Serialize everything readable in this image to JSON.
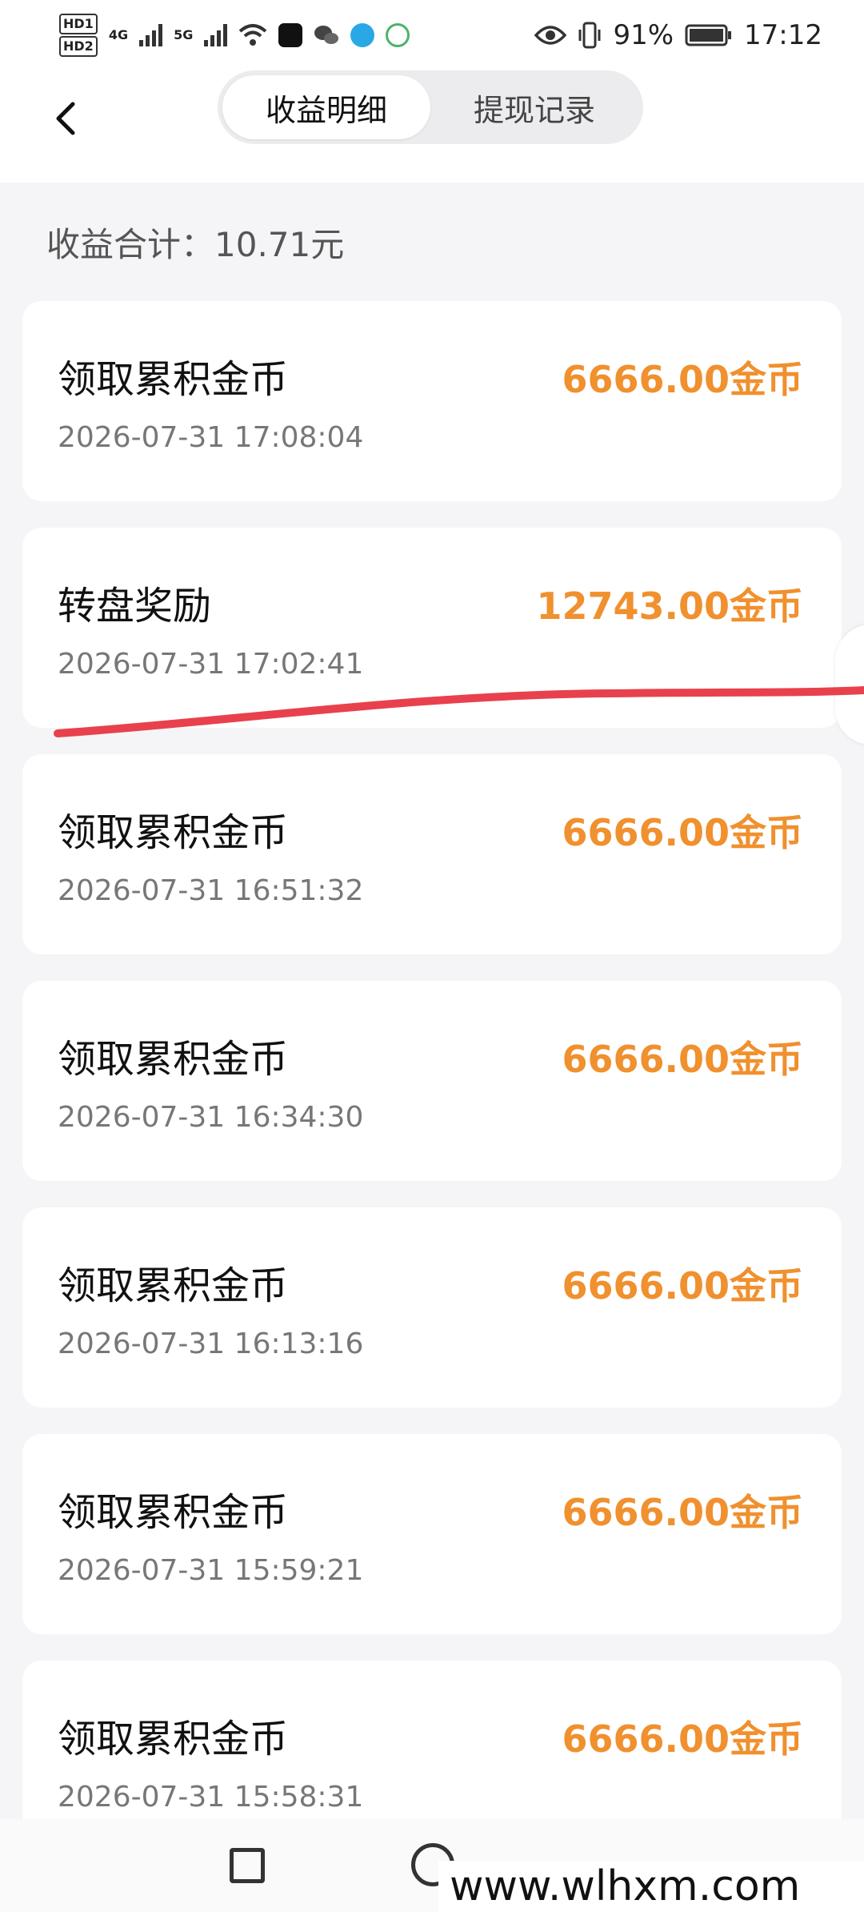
{
  "status_bar": {
    "hd1": "HD1",
    "hd2": "HD2",
    "net1": "4G",
    "net2": "5G",
    "battery": "91%",
    "time": "17:12"
  },
  "tabs": [
    {
      "label": "收益明细",
      "active": true
    },
    {
      "label": "提现记录",
      "active": false
    }
  ],
  "summary": {
    "text": "收益合计：10.71元"
  },
  "records": [
    {
      "title": "领取累积金币",
      "time": "2026-07-31 17:08:04",
      "amount": "6666.00金币"
    },
    {
      "title": "转盘奖励",
      "time": "2026-07-31 17:02:41",
      "amount": "12743.00金币"
    },
    {
      "title": "领取累积金币",
      "time": "2026-07-31 16:51:32",
      "amount": "6666.00金币"
    },
    {
      "title": "领取累积金币",
      "time": "2026-07-31 16:34:30",
      "amount": "6666.00金币"
    },
    {
      "title": "领取累积金币",
      "time": "2026-07-31 16:13:16",
      "amount": "6666.00金币"
    },
    {
      "title": "领取累积金币",
      "time": "2026-07-31 15:59:21",
      "amount": "6666.00金币"
    },
    {
      "title": "领取累积金币",
      "time": "2026-07-31 15:58:31",
      "amount": "6666.00金币"
    }
  ],
  "colors": {
    "amount": "#f0902e",
    "annotation_line": "#e8414d",
    "background": "#f5f5f7"
  },
  "watermark": {
    "text": "www.wlhxm.com"
  }
}
